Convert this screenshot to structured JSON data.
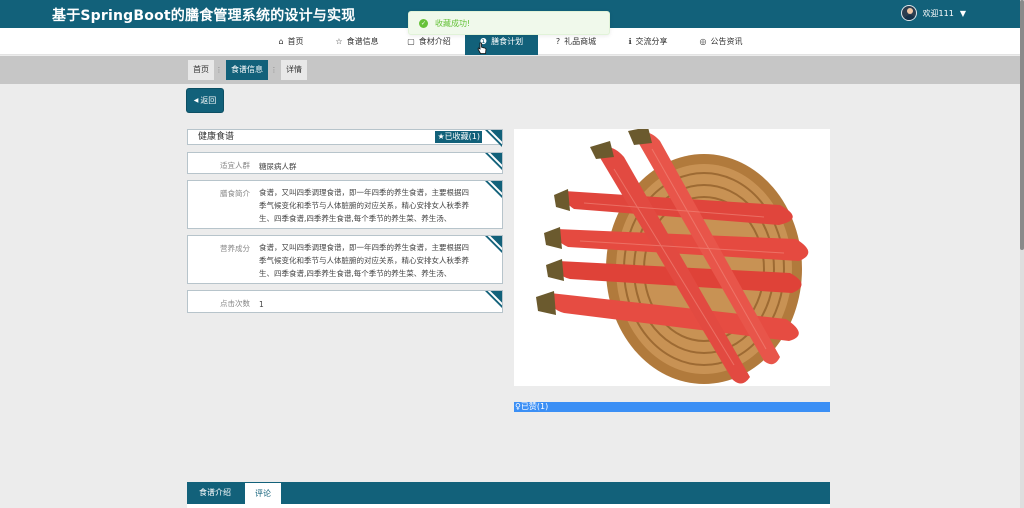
{
  "header": {
    "site_title": "基于SpringBoot的膳食管理系统的设计与实现",
    "welcome": "欢迎111",
    "caret": "▼"
  },
  "toast": {
    "message": "收藏成功!"
  },
  "nav": {
    "items": [
      {
        "icon": "⌂",
        "label": "首页"
      },
      {
        "icon": "☆",
        "label": "食谱信息"
      },
      {
        "icon": "▢",
        "label": "食材介绍"
      },
      {
        "icon": "❶",
        "label": "膳食计划"
      },
      {
        "icon": "?",
        "label": "礼品商城"
      },
      {
        "icon": "ℹ",
        "label": "交流分享"
      },
      {
        "icon": "◎",
        "label": "公告资讯"
      }
    ],
    "active": "膳食计划"
  },
  "breadcrumb": {
    "items": [
      "首页",
      "食谱信息",
      "详情"
    ],
    "separator": "⋮"
  },
  "back_button": {
    "icon": "◀",
    "label": "返回"
  },
  "detail": {
    "name": "健康食谱",
    "favorite": {
      "icon": "★",
      "label": "已收藏(1)"
    },
    "fields": [
      {
        "label": "适宜人群",
        "value": "糖尿病人群"
      },
      {
        "label": "膳食简介",
        "value": "食谱，又叫四季调理食谱，即一年四季的养生食谱，主要根据四季气候变化和季节与人体脏腑的对应关系，精心安排女人秋季养生、四季食谱,四季养生食谱,每个季节的养生菜、养生汤、"
      },
      {
        "label": "营养成分",
        "value": "食谱，又叫四季调理食谱，即一年四季的养生食谱，主要根据四季气候变化和季节与人体脏腑的对应关系，精心安排女人秋季养生、四季食谱,四季养生食谱,每个季节的养生菜、养生汤、"
      },
      {
        "label": "点击次数",
        "value": "1"
      }
    ],
    "like": {
      "icon": "♀",
      "label": "已赞(1)"
    }
  },
  "tabs": [
    "食谱介绍",
    "评论"
  ],
  "colors": {
    "primary": "#12617a",
    "like": "#3b8ff5",
    "success": "#67c23a"
  }
}
